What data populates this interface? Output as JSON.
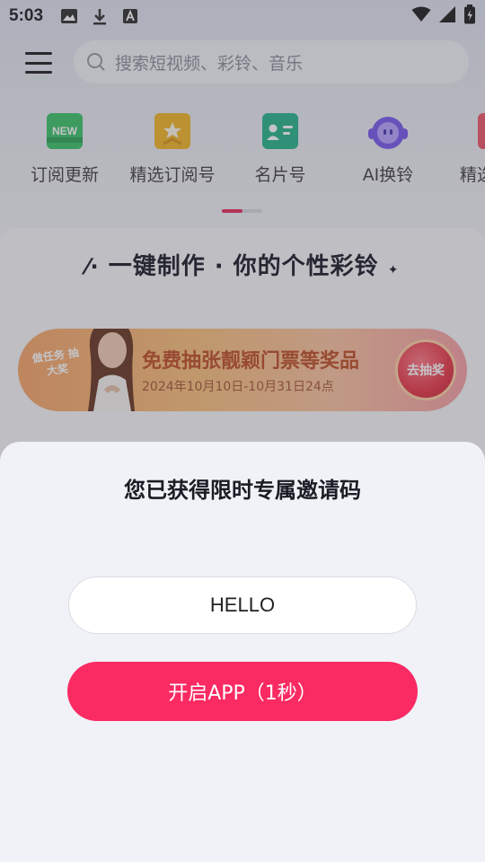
{
  "status_bar": {
    "time": "5:03"
  },
  "search": {
    "placeholder": "搜索短视频、彩铃、音乐"
  },
  "categories": [
    {
      "label": "订阅更新",
      "icon": "new-badge-icon"
    },
    {
      "label": "精选订阅号",
      "icon": "star-bag-icon"
    },
    {
      "label": "名片号",
      "icon": "business-card-icon"
    },
    {
      "label": "AI换铃",
      "icon": "ai-robot-icon"
    },
    {
      "label": "精选",
      "icon": "partial-icon"
    }
  ],
  "card": {
    "slogan": "一键制作 · 你的个性彩铃",
    "banner": {
      "tag": "做任务 抽大奖",
      "title": "免费抽张靓颖门票等奖品",
      "date": "2024年10月10日-10月31日24点",
      "button": "去抽奖"
    }
  },
  "sheet": {
    "title": "您已获得限时专属邀请码",
    "invite_code": "HELLO",
    "open_button": "开启APP（1秒）"
  },
  "colors": {
    "accent": "#fa2a63",
    "indicator": "#e8325c"
  }
}
